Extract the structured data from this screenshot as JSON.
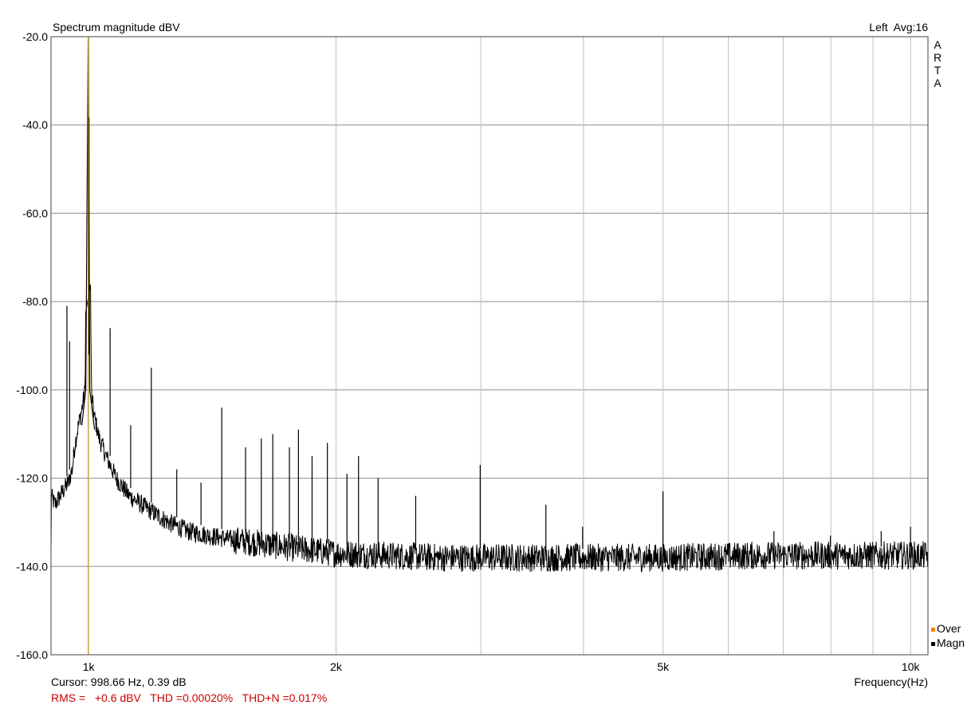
{
  "header": {
    "title": "Spectrum magnitude dBV",
    "channel": "Left",
    "average": "Avg:16",
    "logo": [
      "A",
      "R",
      "T",
      "A"
    ]
  },
  "footer": {
    "cursor": "Cursor: 998.66 Hz, 0.39 dB",
    "measurements": "RMS =   +0.6 dBV   THD =0.00020%   THD+N =0.017%",
    "xlabel": "Frequency(Hz)"
  },
  "legend": [
    {
      "label": "Over",
      "color": "#ff7f00"
    },
    {
      "label": "Magn",
      "color": "#000000"
    }
  ],
  "chart_data": {
    "type": "line",
    "title": "Spectrum magnitude dBV",
    "xlabel": "Frequency(Hz)",
    "ylabel": "",
    "x_scale": "log",
    "xlim": [
      900,
      10500
    ],
    "ylim": [
      -160,
      -20
    ],
    "grid": true,
    "y_ticks": [
      -20,
      -40,
      -60,
      -80,
      -100,
      -120,
      -140,
      -160
    ],
    "y_tick_labels": [
      "-20.0",
      "-40.0",
      "-60.0",
      "-80.0",
      "-100.0",
      "-120.0",
      "-140.0",
      "-160.0"
    ],
    "x_ticks_labeled": [
      1000,
      2000,
      5000,
      10000
    ],
    "x_tick_labels": [
      "1k",
      "2k",
      "5k",
      "10k"
    ],
    "x_grid": [
      1000,
      2000,
      3000,
      4000,
      5000,
      6000,
      7000,
      8000,
      9000,
      10000
    ],
    "cursor": {
      "x": 998.66,
      "color": "#c8a000"
    },
    "series": [
      {
        "name": "Magn",
        "color": "#000000",
        "points": [
          [
            900,
            -124
          ],
          [
            910,
            -126
          ],
          [
            930,
            -123
          ],
          [
            945,
            -121
          ],
          [
            955,
            -118
          ],
          [
            963,
            -112
          ],
          [
            972,
            -108
          ],
          [
            982,
            -104
          ],
          [
            990,
            -100
          ],
          [
            998.66,
            -20
          ],
          [
            1008,
            -101
          ],
          [
            1016,
            -106
          ],
          [
            1030,
            -111
          ],
          [
            1050,
            -115
          ],
          [
            1080,
            -120
          ],
          [
            1120,
            -124
          ],
          [
            1180,
            -127
          ],
          [
            1250,
            -130
          ],
          [
            1320,
            -132
          ],
          [
            1400,
            -133
          ],
          [
            1500,
            -134
          ],
          [
            1650,
            -135
          ],
          [
            1800,
            -136
          ],
          [
            2000,
            -137
          ],
          [
            2300,
            -137.5
          ],
          [
            2700,
            -138
          ],
          [
            3200,
            -138
          ],
          [
            4000,
            -138
          ],
          [
            5000,
            -138
          ],
          [
            6500,
            -137.5
          ],
          [
            8000,
            -137.5
          ],
          [
            10500,
            -137.5
          ]
        ],
        "peaks": [
          [
            941,
            -81
          ],
          [
            948,
            -89
          ],
          [
            958,
            -114
          ],
          [
            1001,
            -92
          ],
          [
            1062,
            -86
          ],
          [
            1125,
            -108
          ],
          [
            1192,
            -95
          ],
          [
            1280,
            -118
          ],
          [
            1370,
            -121
          ],
          [
            1452,
            -104
          ],
          [
            1552,
            -113
          ],
          [
            1622,
            -111
          ],
          [
            1675,
            -110
          ],
          [
            1755,
            -113
          ],
          [
            1800,
            -109
          ],
          [
            1870,
            -115
          ],
          [
            1952,
            -112
          ],
          [
            2062,
            -119
          ],
          [
            2130,
            -115
          ],
          [
            2250,
            -120
          ],
          [
            2500,
            -124
          ],
          [
            2995,
            -117
          ],
          [
            3600,
            -126
          ],
          [
            3990,
            -131
          ],
          [
            4998,
            -123
          ],
          [
            6820,
            -132
          ],
          [
            7990,
            -133
          ],
          [
            9210,
            -132
          ],
          [
            9999,
            -131
          ]
        ]
      }
    ]
  }
}
